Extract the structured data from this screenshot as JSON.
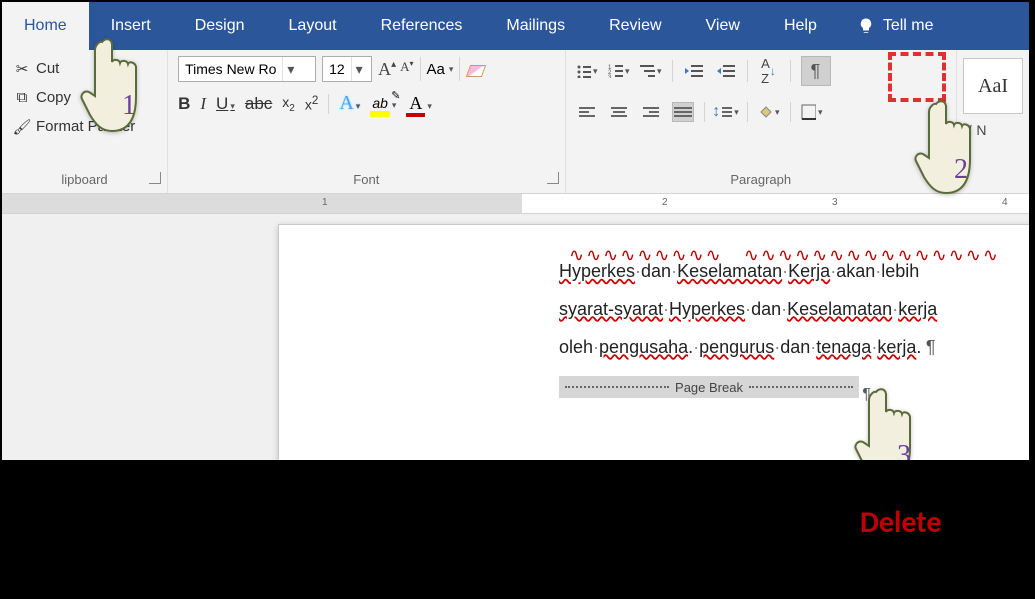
{
  "tabs": {
    "home": "Home",
    "insert": "Insert",
    "design": "Design",
    "layout": "Layout",
    "references": "References",
    "mailings": "Mailings",
    "review": "Review",
    "view": "View",
    "help": "Help",
    "tell_me": "Tell me"
  },
  "clipboard": {
    "cut": "Cut",
    "copy": "Copy",
    "format_painter": "Format Painter",
    "label": "lipboard"
  },
  "font": {
    "name": "Times New Ro",
    "size": "12",
    "label": "Font"
  },
  "paragraph": {
    "label": "Paragraph"
  },
  "styles": {
    "preview1": "AaI",
    "preview2": "¶ N"
  },
  "ruler": {
    "n1": "1",
    "n2": "2",
    "n3": "3",
    "n4": "4"
  },
  "document": {
    "line1_a": "Hyperkes",
    "line1_b": "dan",
    "line1_c": "Keselamatan",
    "line1_d": "Kerja",
    "line1_e": "akan",
    "line1_f": "lebih",
    "line2_a": "syarat-syarat",
    "line2_b": "Hyperkes",
    "line2_c": "dan",
    "line2_d": "Keselamatan",
    "line2_e": "kerja",
    "line3_a": "oleh",
    "line3_b": "pengusaha",
    "line3_c": "pengurus",
    "line3_d": "dan",
    "line3_e": "tenaga",
    "line3_f": "kerja",
    "page_break": "Page Break"
  },
  "callouts": {
    "n1": "1",
    "n2": "2",
    "n3": "3",
    "delete": "Delete"
  }
}
